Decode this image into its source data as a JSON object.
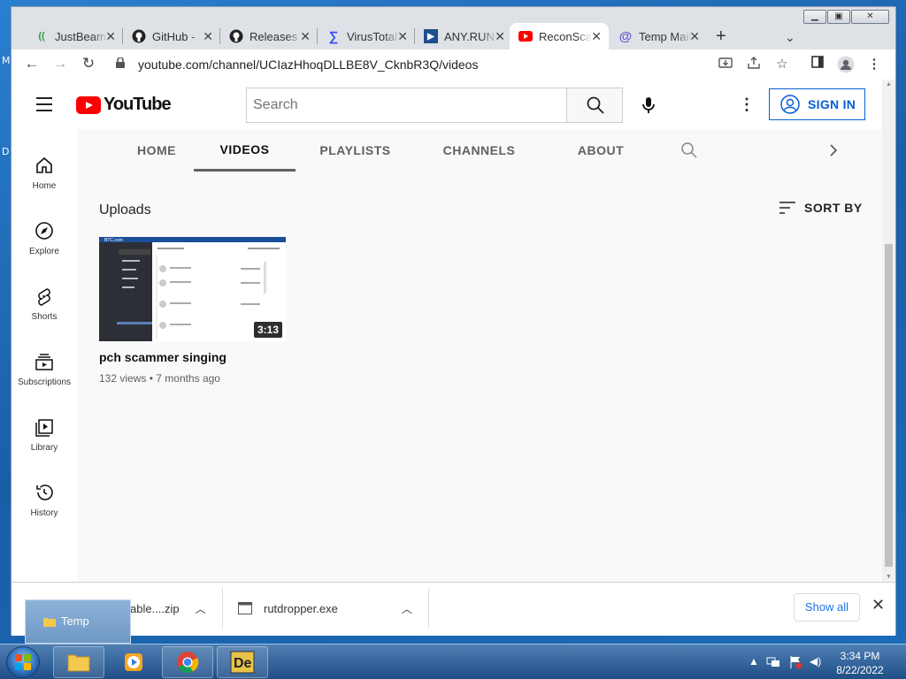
{
  "desktop": {
    "side_letters": [
      "M",
      "D"
    ]
  },
  "browser": {
    "tabs": [
      {
        "title": "JustBeam",
        "icon": "justbeam-icon"
      },
      {
        "title": "GitHub -",
        "icon": "github-icon"
      },
      {
        "title": "Releases",
        "icon": "github-icon"
      },
      {
        "title": "VirusTotal",
        "icon": "virustotal-icon"
      },
      {
        "title": "ANY.RUN",
        "icon": "anyrun-icon"
      },
      {
        "title": "ReconScan",
        "icon": "youtube-icon"
      },
      {
        "title": "Temp Mail",
        "icon": "tempmail-icon"
      }
    ],
    "active_tab_index": 5,
    "url": "youtube.com/channel/UCIazHhoqDLLBE8V_CknbR3Q/videos"
  },
  "youtube": {
    "logo_text": "YouTube",
    "search_placeholder": "Search",
    "sign_in": "SIGN IN",
    "guide": [
      {
        "label": "Home"
      },
      {
        "label": "Explore"
      },
      {
        "label": "Shorts"
      },
      {
        "label": "Subscriptions"
      },
      {
        "label": "Library"
      },
      {
        "label": "History"
      }
    ],
    "channel_tabs": [
      "HOME",
      "VIDEOS",
      "PLAYLISTS",
      "CHANNELS",
      "ABOUT"
    ],
    "active_channel_tab": "VIDEOS",
    "section_title": "Uploads",
    "sort_label": "SORT BY",
    "video": {
      "title": "pch scammer singing",
      "views": "132 views",
      "age": "7 months ago",
      "meta_sep": "•",
      "duration": "3:13",
      "thumb_site": "BTC.com"
    }
  },
  "downloads": {
    "items": [
      {
        "name": "able....zip"
      },
      {
        "name": "rutdropper.exe"
      }
    ],
    "show_all": "Show all"
  },
  "popup": {
    "label": "Temp"
  },
  "taskbar": {
    "time": "3:34 PM",
    "date": "8/22/2022"
  },
  "colors": {
    "youtube_red": "#ff0000",
    "link_blue": "#065fd4"
  }
}
